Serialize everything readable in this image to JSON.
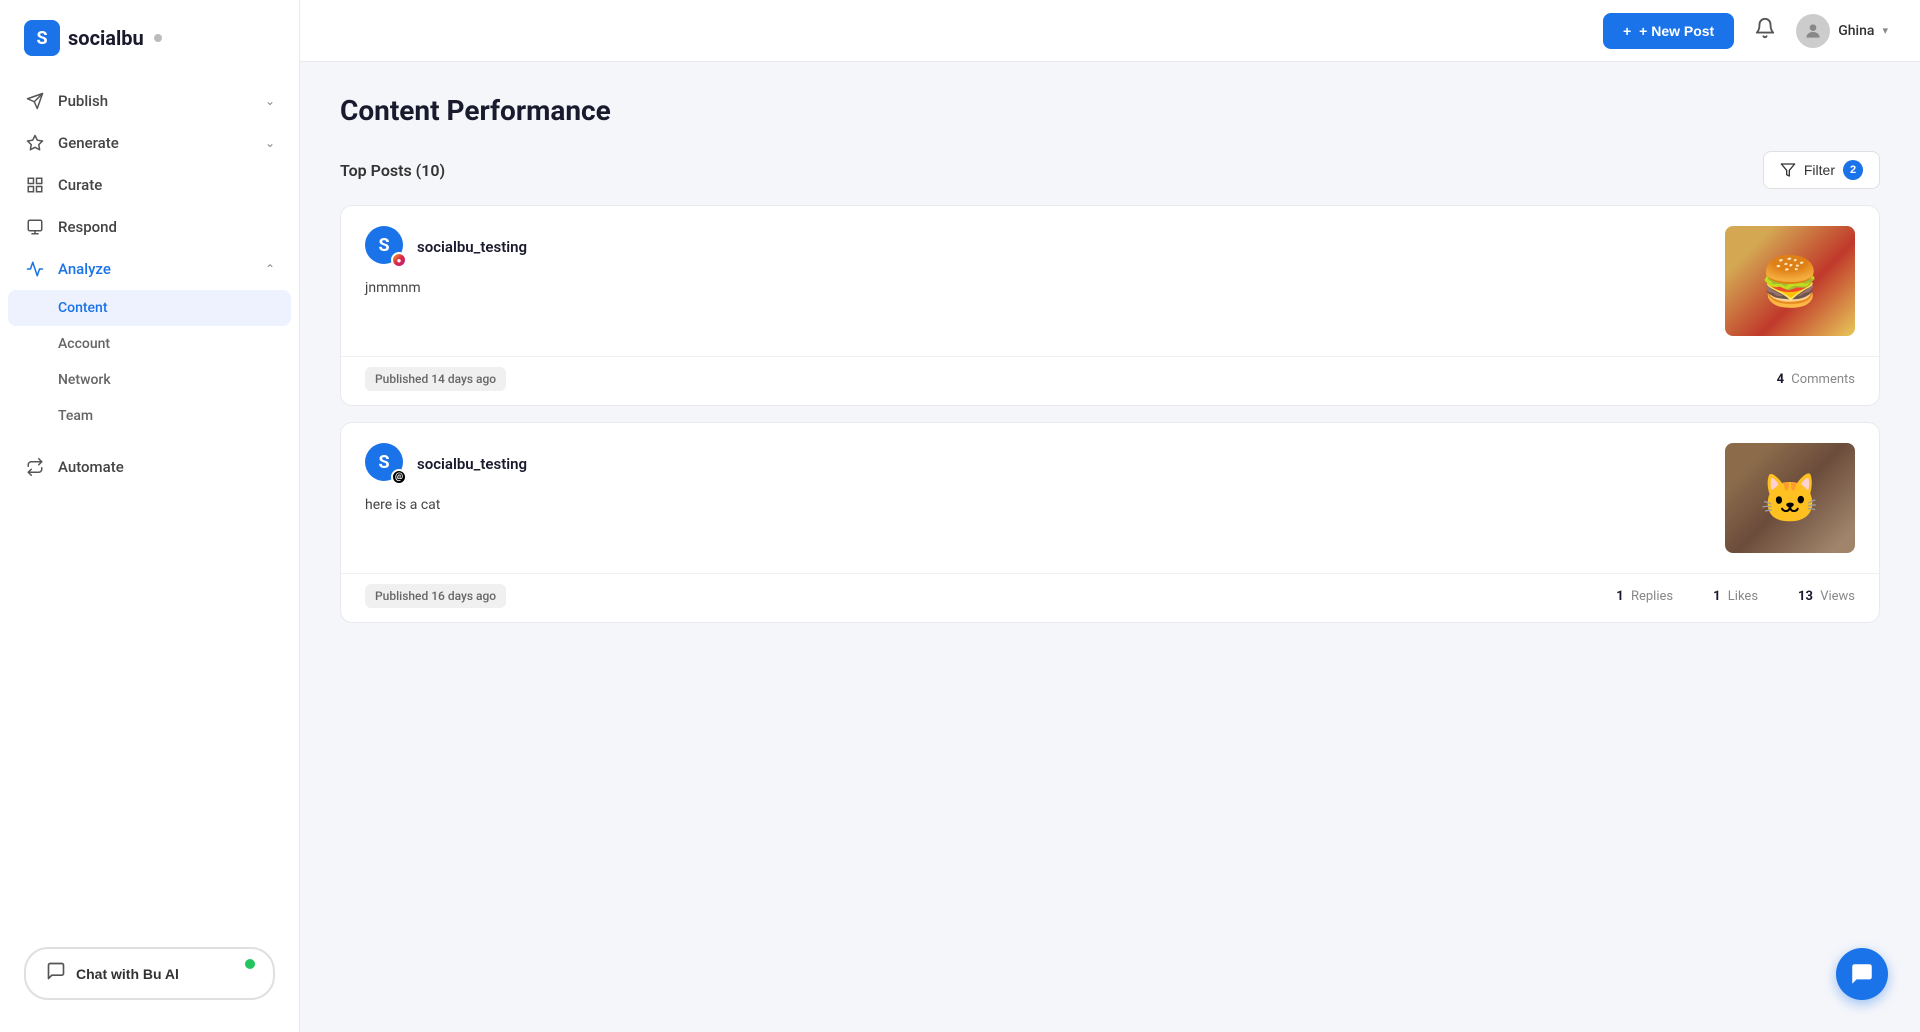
{
  "brand": {
    "name": "socialbu",
    "logo_letter": "S",
    "status_dot": "gray"
  },
  "header": {
    "new_post_label": "+ New Post",
    "user_name": "Ghina"
  },
  "sidebar": {
    "nav_items": [
      {
        "id": "publish",
        "label": "Publish",
        "icon": "send",
        "has_chevron": true,
        "expanded": false
      },
      {
        "id": "generate",
        "label": "Generate",
        "icon": "sparkle",
        "has_chevron": true,
        "expanded": false
      },
      {
        "id": "curate",
        "label": "Curate",
        "icon": "grid",
        "has_chevron": false
      },
      {
        "id": "respond",
        "label": "Respond",
        "icon": "chat",
        "has_chevron": false
      },
      {
        "id": "analyze",
        "label": "Analyze",
        "icon": "chart",
        "has_chevron": true,
        "expanded": true,
        "active": true
      }
    ],
    "analyze_sub_items": [
      {
        "id": "content",
        "label": "Content",
        "active": true
      },
      {
        "id": "account",
        "label": "Account",
        "active": false
      },
      {
        "id": "network",
        "label": "Network",
        "active": false
      },
      {
        "id": "team",
        "label": "Team",
        "active": false
      }
    ],
    "automate": {
      "label": "Automate",
      "icon": "automate"
    },
    "chat_btn": {
      "label": "Chat with Bu Al"
    }
  },
  "page": {
    "title": "Content Performance",
    "top_posts_label": "Top Posts (10)",
    "filter_label": "Filter",
    "filter_badge": "2"
  },
  "posts": [
    {
      "id": "post1",
      "username": "socialbu_testing",
      "platform": "instagram",
      "text": "jnmmnm",
      "published_label": "Published 14 days ago",
      "has_image": true,
      "image_type": "burger",
      "stats": {
        "comments": "4",
        "comments_label": "Comments",
        "replies": null,
        "likes": null,
        "views": null
      }
    },
    {
      "id": "post2",
      "username": "socialbu_testing",
      "platform": "threads",
      "text": "here is a cat",
      "published_label": "Published 16 days ago",
      "has_image": true,
      "image_type": "cat",
      "stats": {
        "comments": null,
        "replies": "1",
        "replies_label": "Replies",
        "likes": "1",
        "likes_label": "Likes",
        "views": "13",
        "views_label": "Views"
      }
    }
  ]
}
